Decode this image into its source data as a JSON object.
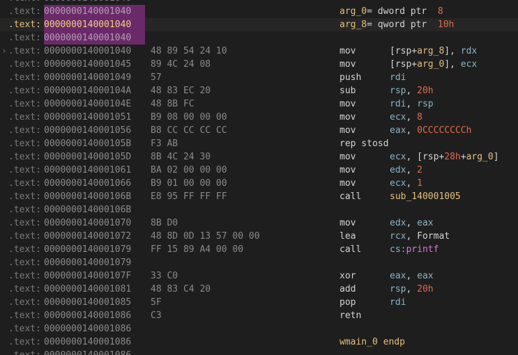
{
  "segment": ".text:",
  "rows": [
    {
      "addr": "0000000140001040",
      "kind": "blank"
    },
    {
      "addr": "0000000140001040",
      "kind": "var",
      "name": "arg_0",
      "decl": "= dword ptr  ",
      "val": "8",
      "current": false
    },
    {
      "addr": "0000000140001040",
      "kind": "var",
      "name": "arg_8",
      "decl": "= qword ptr  ",
      "val": "10h",
      "current": true
    },
    {
      "addr": "0000000140001040",
      "kind": "blank"
    },
    {
      "addr": "0000000140001040",
      "bytes": "48 89 54 24 10",
      "mnem": "mov",
      "ops": [
        {
          "t": "[rsp+",
          "c": "plain"
        },
        {
          "t": "arg_8",
          "c": "var"
        },
        {
          "t": "], ",
          "c": "plain"
        },
        {
          "t": "rdx",
          "c": "reg"
        }
      ],
      "arrow": true
    },
    {
      "addr": "0000000140001045",
      "bytes": "89 4C 24 08",
      "mnem": "mov",
      "ops": [
        {
          "t": "[rsp+",
          "c": "plain"
        },
        {
          "t": "arg_0",
          "c": "var"
        },
        {
          "t": "], ",
          "c": "plain"
        },
        {
          "t": "ecx",
          "c": "reg"
        }
      ]
    },
    {
      "addr": "0000000140001049",
      "bytes": "57",
      "mnem": "push",
      "ops": [
        {
          "t": "rdi",
          "c": "reg"
        }
      ]
    },
    {
      "addr": "000000014000104A",
      "bytes": "48 83 EC 20",
      "mnem": "sub",
      "ops": [
        {
          "t": "rsp",
          "c": "reg"
        },
        {
          "t": ", ",
          "c": "plain"
        },
        {
          "t": "20h",
          "c": "num"
        }
      ]
    },
    {
      "addr": "000000014000104E",
      "bytes": "48 8B FC",
      "mnem": "mov",
      "ops": [
        {
          "t": "rdi",
          "c": "reg"
        },
        {
          "t": ", ",
          "c": "plain"
        },
        {
          "t": "rsp",
          "c": "reg"
        }
      ]
    },
    {
      "addr": "0000000140001051",
      "bytes": "B9 08 00 00 00",
      "mnem": "mov",
      "ops": [
        {
          "t": "ecx",
          "c": "reg"
        },
        {
          "t": ", ",
          "c": "plain"
        },
        {
          "t": "8",
          "c": "num"
        }
      ]
    },
    {
      "addr": "0000000140001056",
      "bytes": "B8 CC CC CC CC",
      "mnem": "mov",
      "ops": [
        {
          "t": "eax",
          "c": "reg"
        },
        {
          "t": ", ",
          "c": "plain"
        },
        {
          "t": "0CCCCCCCCh",
          "c": "num"
        }
      ]
    },
    {
      "addr": "000000014000105B",
      "bytes": "F3 AB",
      "mnem": "rep stosd",
      "ops": []
    },
    {
      "addr": "000000014000105D",
      "bytes": "8B 4C 24 30",
      "mnem": "mov",
      "ops": [
        {
          "t": "ecx",
          "c": "reg"
        },
        {
          "t": ", [rsp+",
          "c": "plain"
        },
        {
          "t": "28h",
          "c": "num"
        },
        {
          "t": "+",
          "c": "plain"
        },
        {
          "t": "arg_0",
          "c": "var"
        },
        {
          "t": "]",
          "c": "plain"
        }
      ]
    },
    {
      "addr": "0000000140001061",
      "bytes": "BA 02 00 00 00",
      "mnem": "mov",
      "ops": [
        {
          "t": "edx",
          "c": "reg"
        },
        {
          "t": ", ",
          "c": "plain"
        },
        {
          "t": "2",
          "c": "num"
        }
      ]
    },
    {
      "addr": "0000000140001066",
      "bytes": "B9 01 00 00 00",
      "mnem": "mov",
      "ops": [
        {
          "t": "ecx",
          "c": "reg"
        },
        {
          "t": ", ",
          "c": "plain"
        },
        {
          "t": "1",
          "c": "num"
        }
      ]
    },
    {
      "addr": "000000014000106B",
      "bytes": "E8 95 FF FF FF",
      "mnem": "call",
      "ops": [
        {
          "t": "sub_140001005",
          "c": "var"
        }
      ]
    },
    {
      "addr": "000000014000106B",
      "kind": "blank"
    },
    {
      "addr": "0000000140001070",
      "bytes": "8B D0",
      "mnem": "mov",
      "ops": [
        {
          "t": "edx",
          "c": "reg"
        },
        {
          "t": ", ",
          "c": "plain"
        },
        {
          "t": "eax",
          "c": "reg"
        }
      ]
    },
    {
      "addr": "0000000140001072",
      "bytes": "48 8D 0D 13 57 00 00",
      "mnem": "lea",
      "ops": [
        {
          "t": "rcx",
          "c": "reg"
        },
        {
          "t": ", Format",
          "c": "plain"
        }
      ]
    },
    {
      "addr": "0000000140001079",
      "bytes": "FF 15 89 A4 00 00",
      "mnem": "call",
      "ops": [
        {
          "t": "cs:",
          "c": "reg"
        },
        {
          "t": "printf",
          "c": "ext"
        }
      ]
    },
    {
      "addr": "0000000140001079",
      "kind": "blank"
    },
    {
      "addr": "000000014000107F",
      "bytes": "33 C0",
      "mnem": "xor",
      "ops": [
        {
          "t": "eax",
          "c": "reg"
        },
        {
          "t": ", ",
          "c": "plain"
        },
        {
          "t": "eax",
          "c": "reg"
        }
      ]
    },
    {
      "addr": "0000000140001081",
      "bytes": "48 83 C4 20",
      "mnem": "add",
      "ops": [
        {
          "t": "rsp",
          "c": "reg"
        },
        {
          "t": ", ",
          "c": "plain"
        },
        {
          "t": "20h",
          "c": "num"
        }
      ]
    },
    {
      "addr": "0000000140001085",
      "bytes": "5F",
      "mnem": "pop",
      "ops": [
        {
          "t": "rdi",
          "c": "reg"
        }
      ]
    },
    {
      "addr": "0000000140001086",
      "bytes": "C3",
      "mnem": "retn",
      "ops": []
    },
    {
      "addr": "0000000140001086",
      "kind": "blank"
    },
    {
      "addr": "0000000140001086",
      "kind": "endp",
      "text": "wmain_0 endp"
    },
    {
      "addr": "0000000140001086",
      "kind": "blank"
    }
  ],
  "colors": {
    "highlight": "#6a2a6a",
    "number": "#e06c4a",
    "label": "#e5c07b",
    "register": "#8ab4c8",
    "import": "#d67ad6"
  }
}
